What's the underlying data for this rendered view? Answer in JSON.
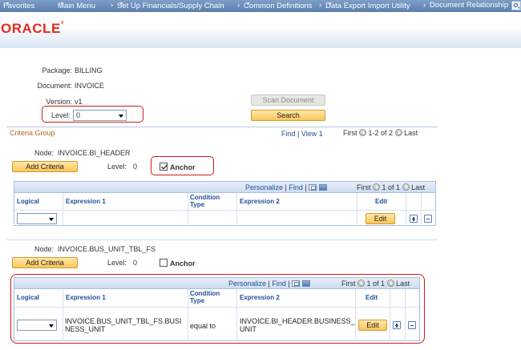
{
  "nav": {
    "favorites": "Favorites",
    "main_menu": "Main Menu",
    "setup": "Set Up Financials/Supply Chain",
    "common_defs": "Common Definitions",
    "data_export": "Data Export Import Utility",
    "doc_rel": "Document Relationship"
  },
  "logo": {
    "text": "ORACLE",
    "mark": "®"
  },
  "form": {
    "package_label": "Package:",
    "package_value": "BILLING",
    "document_label": "Document:",
    "document_value": "INVOICE",
    "version_label": "Version:",
    "version_value": "v1",
    "level_label": "Level:",
    "level_value": "0",
    "scan_button": "Scan Document",
    "search_button": "Search"
  },
  "criteria_group": {
    "title": "Criteria Group",
    "find": "Find",
    "sep": "|",
    "view1": "View 1",
    "first": "First",
    "range": "1-2 of 2",
    "last": "Last"
  },
  "node1": {
    "node_label": "Node:",
    "node_value": "INVOICE.BI_HEADER",
    "add_criteria": "Add Criteria",
    "level_label": "Level:",
    "level_value": "0",
    "anchor_label": "Anchor",
    "anchor_checked": true,
    "grid": {
      "personalize": "Personalize",
      "find": "Find",
      "sep": "|",
      "first": "First",
      "range": "1 of 1",
      "last": "Last",
      "headers": {
        "logical": "Logical",
        "expr1": "Expression 1",
        "cond": "Condition Type",
        "expr2": "Expression 2",
        "edit": "Edit"
      },
      "row": {
        "logical": "",
        "expr1": "",
        "cond": "",
        "expr2": "",
        "edit_button": "Edit"
      }
    }
  },
  "node2": {
    "node_label": "Node:",
    "node_value": "INVOICE.BUS_UNIT_TBL_FS",
    "add_criteria": "Add Criteria",
    "level_label": "Level:",
    "level_value": "0",
    "anchor_label": "Anchor",
    "anchor_checked": false,
    "grid": {
      "personalize": "Personalize",
      "find": "Find",
      "sep": "|",
      "first": "First",
      "range": "1 of 1",
      "last": "Last",
      "headers": {
        "logical": "Logical",
        "expr1": "Expression 1",
        "cond": "Condition Type",
        "expr2": "Expression 2",
        "edit": "Edit"
      },
      "row": {
        "logical": "",
        "expr1": "INVOICE.BUS_UNIT_TBL_FS.BUSINESS_UNIT",
        "cond": "equal to",
        "expr2": "INVOICE.BI_HEADER.BUSINESS_UNIT",
        "edit_button": "Edit"
      }
    }
  },
  "colors": {
    "accent": "#1f4e9a",
    "highlight": "#d11a1a",
    "brand": "#e4281c",
    "button": "#f9c75c"
  }
}
